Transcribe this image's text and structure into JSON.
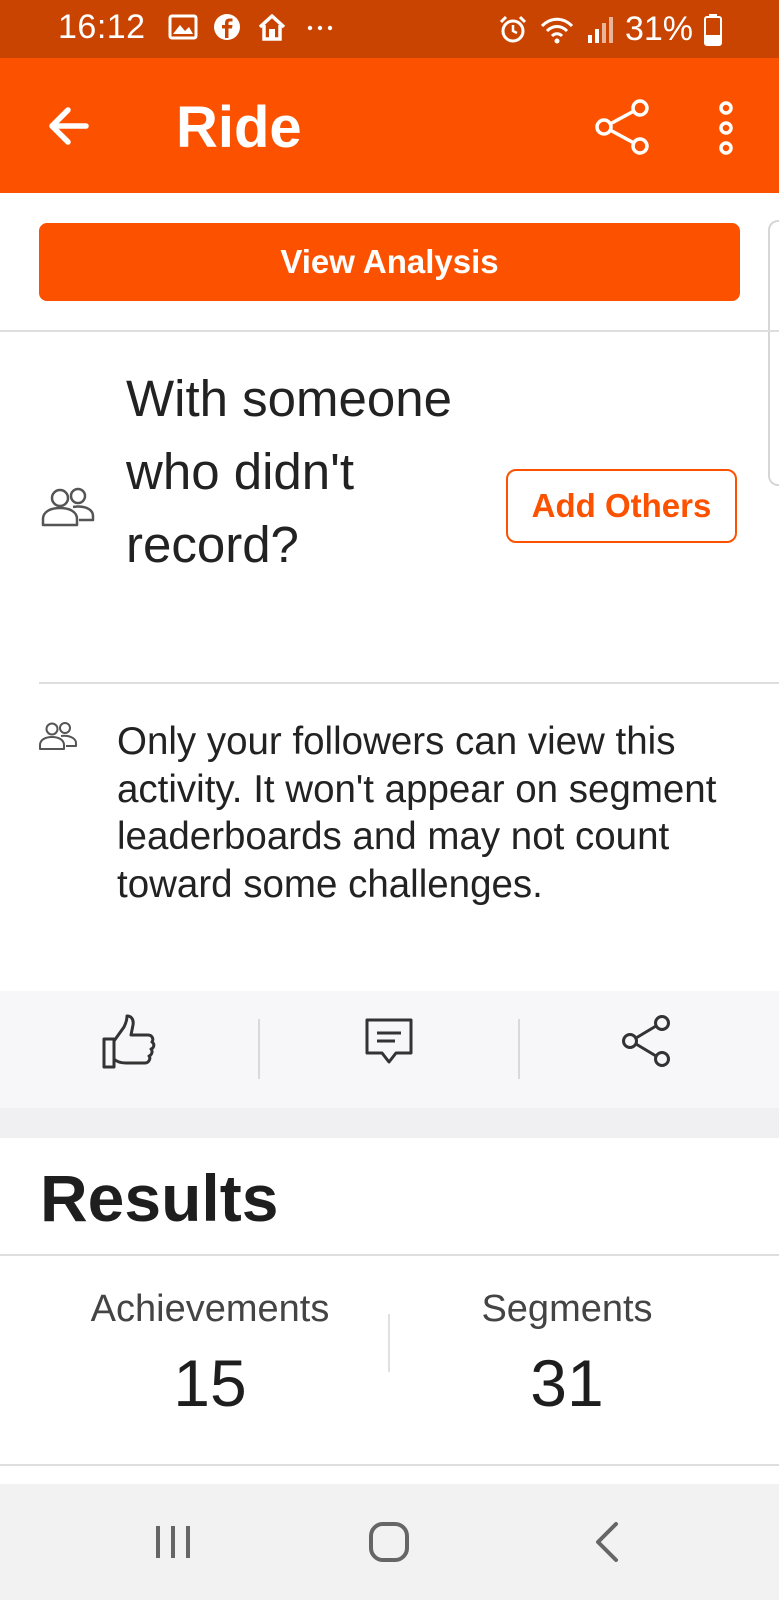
{
  "status_bar": {
    "time": "16:12",
    "battery": "31%",
    "left_icons": [
      "image-icon",
      "facebook-icon",
      "home-icon",
      "more-notifications-icon"
    ],
    "right_icons": [
      "alarm-icon",
      "wifi-icon",
      "signal-icon",
      "battery-icon"
    ]
  },
  "app_bar": {
    "title": "Ride",
    "back_icon": "arrow-left-icon",
    "share_icon": "share-icon",
    "more_icon": "more-vertical-icon"
  },
  "view_analysis": {
    "label": "View Analysis"
  },
  "with_others": {
    "prompt": "With someone who didn't record?",
    "button_label": "Add Others",
    "icon": "people-icon"
  },
  "privacy": {
    "text": "Only your followers can view this activity. It won't appear on segment leaderboards and may not count toward some challenges.",
    "icon": "people-icon"
  },
  "social_actions": {
    "items": [
      "thumbs-up-icon",
      "comment-icon",
      "share-icon"
    ]
  },
  "results": {
    "title": "Results",
    "stats": [
      {
        "label": "Achievements",
        "value": "15"
      },
      {
        "label": "Segments",
        "value": "31"
      }
    ]
  },
  "nav_bar": {
    "items": [
      "recents-icon",
      "home-icon",
      "back-icon"
    ]
  },
  "colors": {
    "brand": "#fc5200",
    "status_bar": "#c94400",
    "text": "#222222",
    "social_bar": "#f7f7f9",
    "nav_bar": "#f2f2f2"
  }
}
